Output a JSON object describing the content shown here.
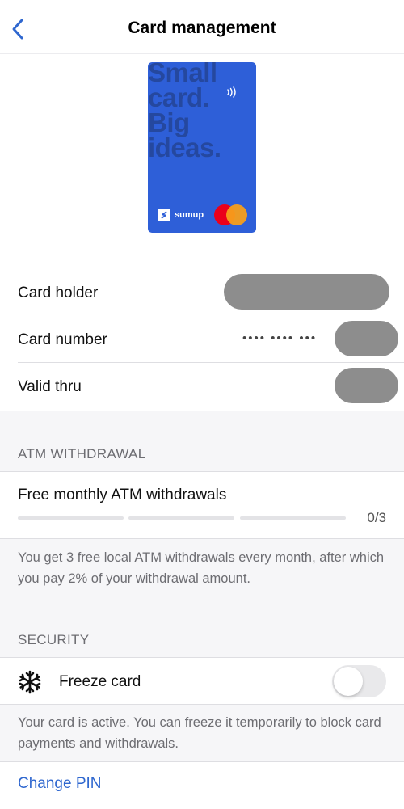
{
  "header": {
    "title": "Card management",
    "back_icon": "chevron-left-icon"
  },
  "card": {
    "slogan": "Small\ncard.\nBig\nideas.",
    "brand": "sumup",
    "network": "mastercard",
    "contactless_icon": "contactless-icon",
    "colors": {
      "card": "#2e5fd8",
      "slogan": "#25489f"
    }
  },
  "details": {
    "holder_label": "Card holder",
    "number_label": "Card number",
    "number_masked": "•••• •••• •••",
    "valid_label": "Valid thru"
  },
  "atm": {
    "section_title": "ATM WITHDRAWAL",
    "row_title": "Free monthly ATM withdrawals",
    "count": "0/3",
    "used": 0,
    "total": 3,
    "note": "You get 3 free local ATM withdrawals every month, after which you pay 2% of your withdrawal amount."
  },
  "security": {
    "section_title": "SECURITY",
    "freeze_label": "Freeze card",
    "freeze_icon": "snowflake-icon",
    "freeze_on": false,
    "note": "Your card is active. You can freeze it temporarily to block card payments and withdrawals.",
    "change_pin": "Change PIN"
  },
  "colors": {
    "accent": "#2f67cf",
    "background": "#f6f6f8",
    "redaction": "#8d8d8d"
  }
}
